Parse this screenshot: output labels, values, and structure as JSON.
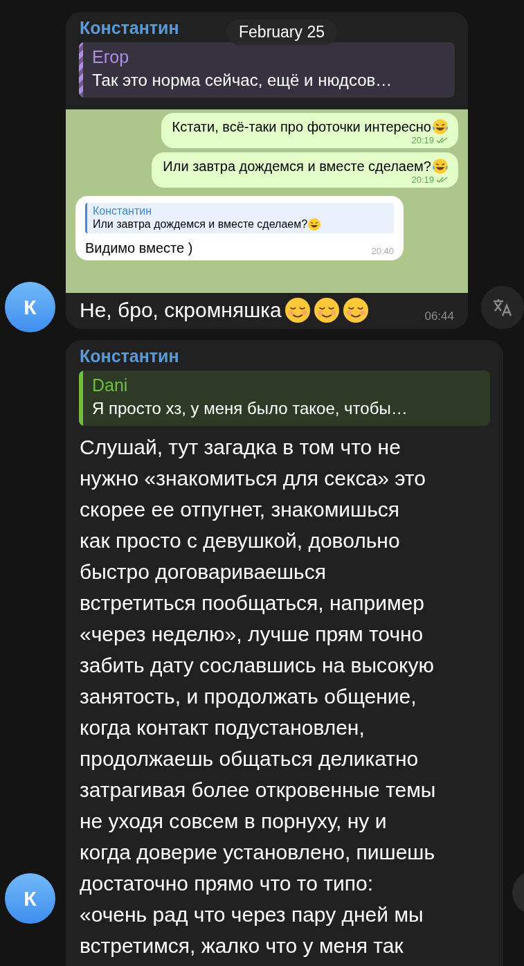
{
  "date_badge": "February 25",
  "messages": [
    {
      "sender": "Константин",
      "avatar": "К",
      "reply": {
        "author": "Егор",
        "text": "Так это норма сейчас, ещё и нюдсов…",
        "kind": "striped",
        "color": "#b08ee8"
      },
      "screenshot": {
        "messages": [
          {
            "kind": "outgoing",
            "text": "Кстати, всё-таки про фоточки интересно",
            "emoji": [
              {
                "kind": "laughing"
              }
            ],
            "time": "20:19",
            "read": true
          },
          {
            "kind": "outgoing",
            "text": "Или завтра дождемся и вместе сделаем?",
            "emoji": [
              {
                "kind": "laughing"
              }
            ],
            "time": "20:19",
            "read": true
          },
          {
            "kind": "incoming",
            "reply": {
              "author": "Константин",
              "text": "Или завтра дождемся и вместе сделаем?",
              "emoji": [
                {
                  "kind": "laughing"
                }
              ]
            },
            "text": "Видимо вместе )",
            "time": "20:40"
          }
        ]
      },
      "text": "Не, бро, скромняшка",
      "emoji": [
        {
          "kind": "smiling"
        },
        {
          "kind": "smiling"
        },
        {
          "kind": "smiling"
        }
      ],
      "time": "06:44",
      "translate": true
    },
    {
      "sender": "Константин",
      "avatar": "К",
      "reply": {
        "author": "Dani",
        "text": "Я просто хз, у меня было такое, чтобы…",
        "kind": "solid",
        "color": "#6fbf40"
      },
      "text": "Слушай, тут загадка в том что не\nнужно «знакомиться для секса» это\nскорее ее отпугнет, знакомишься\nкак просто с девушкой, довольно\nбыстро договариваешься\nвстретиться пообщаться, например\n«через неделю», лучше прям точно\nзабить дату сославшись на высокую\nзанятость, и продолжать общение,\nкогда контакт подустановлен,\nпродолжаешь общаться деликатно\nзатрагивая более откровенные темы\nне уходя совсем в порнуху, ну и\nкогда доверие установлено, пишешь\nдостаточно прямо что то типо:\n«очень рад что через пару дней мы\nвстретимся, жалко что у меня так"
    }
  ]
}
